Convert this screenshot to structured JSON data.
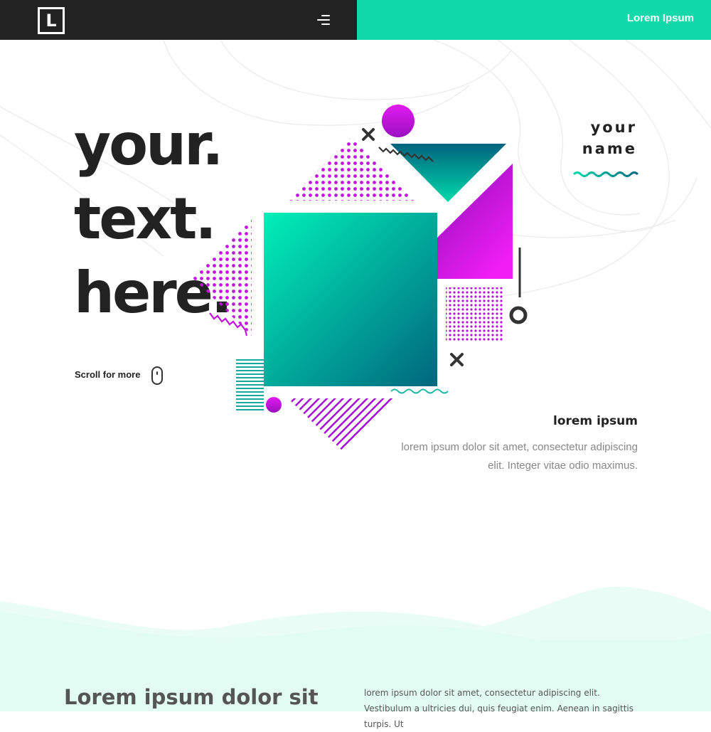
{
  "header": {
    "logo_letter": "L",
    "cta_label": "Lorem Ipsum"
  },
  "hero": {
    "line1": "your.",
    "line2": "text.",
    "line3": "here.",
    "scroll_label": "Scroll for more"
  },
  "name_block": {
    "line1": "your",
    "line2": "name"
  },
  "info": {
    "title": "lorem ipsum",
    "body": "lorem ipsum dolor sit amet, consectetur adipiscing elit. Integer vitae odio maximus."
  },
  "section2": {
    "heading": "Lorem ipsum dolor sit",
    "body": "lorem ipsum dolor sit amet, consectetur adipiscing elit. Vestibulum a ultricies dui, quis feugiat enim. Aenean in sagittis turpis. Ut"
  },
  "colors": {
    "dark": "#222222",
    "teal": "#12d9a9",
    "magenta": "#e011f0",
    "mint": "#e3fcf3"
  },
  "icons": [
    "logo-mark",
    "hamburger-menu-icon",
    "mouse-scroll-icon"
  ]
}
